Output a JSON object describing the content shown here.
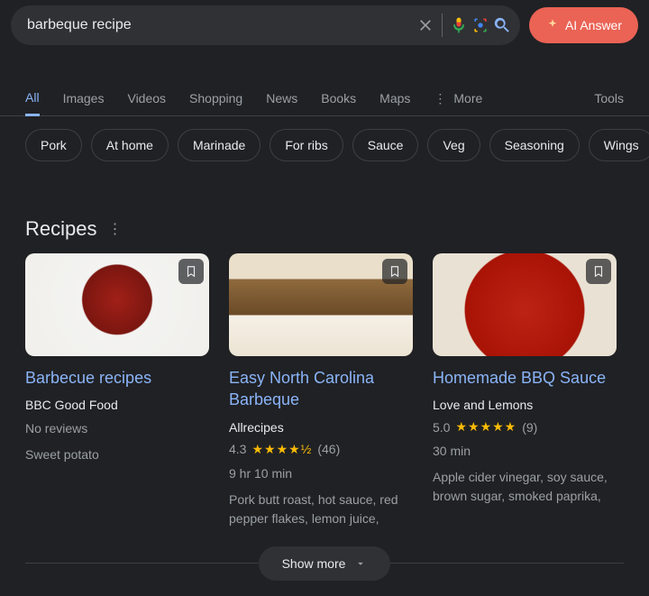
{
  "search": {
    "query": "barbeque recipe"
  },
  "aiAnswer": "AI Answer",
  "tabs": {
    "items": [
      "All",
      "Images",
      "Videos",
      "Shopping",
      "News",
      "Books",
      "Maps"
    ],
    "active": 0,
    "more": "More",
    "tools": "Tools"
  },
  "chips": [
    "Pork",
    "At home",
    "Marinade",
    "For ribs",
    "Sauce",
    "Veg",
    "Seasoning",
    "Wings"
  ],
  "sectionTitle": "Recipes",
  "cards": [
    {
      "title": "Barbecue recipes",
      "source": "BBC Good Food",
      "rating": null,
      "noReviews": "No reviews",
      "time": null,
      "desc": "Sweet potato"
    },
    {
      "title": "Easy North Carolina Barbeque",
      "source": "Allrecipes",
      "rating": {
        "value": "4.3",
        "starsText": "★★★★½",
        "count": "(46)"
      },
      "noReviews": null,
      "time": "9 hr 10 min",
      "desc": "Pork butt roast, hot sauce, red pepper flakes, lemon juice,"
    },
    {
      "title": "Homemade BBQ Sauce",
      "source": "Love and Lemons",
      "rating": {
        "value": "5.0",
        "starsText": "★★★★★",
        "count": "(9)"
      },
      "noReviews": null,
      "time": "30 min",
      "desc": "Apple cider vinegar, soy sauce, brown sugar, smoked paprika,"
    }
  ],
  "showMore": "Show more"
}
